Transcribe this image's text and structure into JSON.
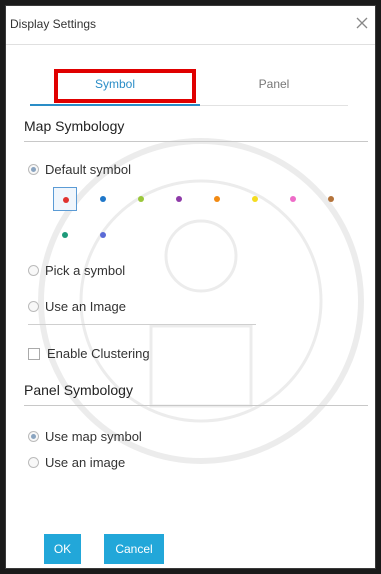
{
  "dialog": {
    "title": "Display Settings",
    "close_icon": "close-icon"
  },
  "tabs": [
    {
      "label": "Symbol",
      "active": true
    },
    {
      "label": "Panel",
      "active": false
    }
  ],
  "map_symbology": {
    "title": "Map Symbology",
    "default_symbol_label": "Default symbol",
    "default_symbol_selected": true,
    "swatches": [
      {
        "color": "#e0322e",
        "selected": true
      },
      {
        "color": "#1f77c9",
        "selected": false
      },
      {
        "color": "#9ac73a",
        "selected": false
      },
      {
        "color": "#8e3aa8",
        "selected": false
      },
      {
        "color": "#f28a12",
        "selected": false
      },
      {
        "color": "#f4dc20",
        "selected": false
      },
      {
        "color": "#ee6cc8",
        "selected": false
      },
      {
        "color": "#b4733a",
        "selected": false
      },
      {
        "color": "#1e9a7a",
        "selected": false
      },
      {
        "color": "#5a6ad6",
        "selected": false
      }
    ],
    "pick_symbol_label": "Pick a symbol",
    "use_image_label": "Use an Image",
    "enable_clustering_label": "Enable Clustering",
    "enable_clustering_checked": false
  },
  "panel_symbology": {
    "title": "Panel Symbology",
    "use_map_symbol_label": "Use map symbol",
    "use_map_symbol_selected": true,
    "use_image_label": "Use an image"
  },
  "footer": {
    "ok_label": "OK",
    "cancel_label": "Cancel",
    "accent": "#22a7d9"
  },
  "colors": {
    "active_tab": "#2a8dc7",
    "highlight": "#e00000"
  }
}
